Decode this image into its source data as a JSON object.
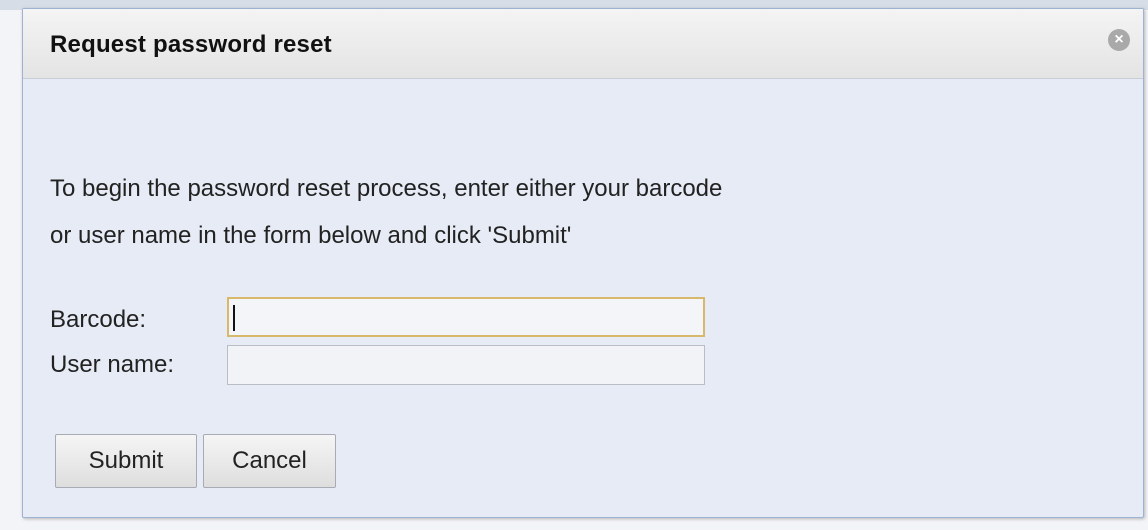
{
  "dialog": {
    "title": "Request password reset",
    "close_symbol": "×",
    "close_icon": "close-circle-icon",
    "instructions": {
      "line1": "To begin the password reset process, enter either your barcode",
      "line2": "or user name in the form below and click 'Submit'"
    },
    "form": {
      "barcode_label": "Barcode:",
      "barcode_value": "",
      "username_label": "User name:",
      "username_value": ""
    },
    "buttons": {
      "submit_label": "Submit",
      "cancel_label": "Cancel"
    }
  },
  "colors": {
    "dialog_background": "#e6ebf5",
    "focus_border": "#d8b96b",
    "dialog_border": "#9db3d1"
  }
}
